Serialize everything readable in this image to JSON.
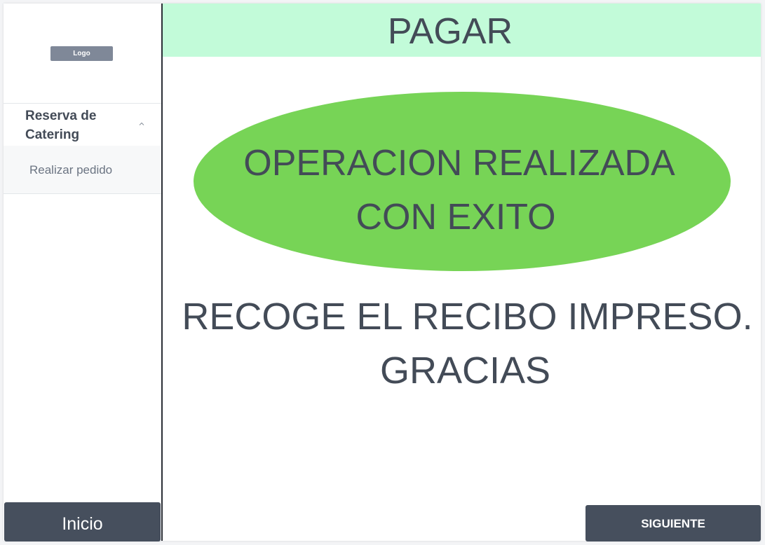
{
  "sidebar": {
    "logo_label": "Logo",
    "section_label": "Reserva de Catering",
    "chevron_icon": "chevron-up-icon",
    "items": [
      {
        "label": "Realizar pedido"
      }
    ],
    "home_button_label": "Inicio"
  },
  "header": {
    "title": "PAGAR",
    "background_color": "#c2fbd9"
  },
  "main": {
    "success_message": [
      "OPERACION REALIZADA",
      "CON EXITO"
    ],
    "success_color": "#77d456",
    "receipt_message": [
      "RECOGE EL RECIBO IMPRESO.",
      "GRACIAS"
    ],
    "next_button_label": "SIGUIENTE"
  },
  "colors": {
    "text": "#434b57",
    "button_bg": "#464f5d",
    "button_text": "#ffffff"
  }
}
